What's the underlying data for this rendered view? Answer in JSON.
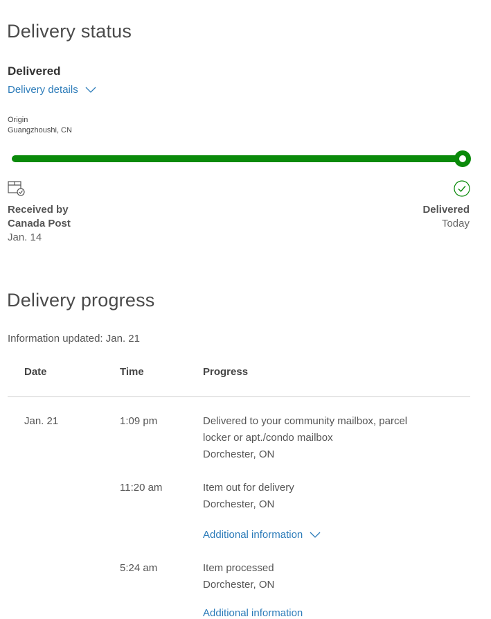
{
  "status": {
    "heading": "Delivery status",
    "value": "Delivered",
    "details_link": "Delivery details",
    "origin_label": "Origin",
    "origin_value": "Guangzhoushi, CN",
    "progress_fraction": 1.0,
    "start_milestone": {
      "line1": "Received by",
      "line2": "Canada Post",
      "date": "Jan. 14",
      "icon": "package-check-icon"
    },
    "end_milestone": {
      "label": "Delivered",
      "date": "Today",
      "icon": "check-circle-icon"
    },
    "accent_color": "#0a8a0a",
    "link_color": "#2b7bb9"
  },
  "progress": {
    "heading": "Delivery progress",
    "updated": "Information updated: Jan. 21",
    "columns": [
      "Date",
      "Time",
      "Progress"
    ],
    "rows": [
      {
        "date": "Jan. 21",
        "time": "1:09 pm",
        "line1": "Delivered to your community mailbox, parcel",
        "line2": "locker or apt./condo mailbox",
        "location": "Dorchester, ON"
      },
      {
        "date": "",
        "time": "11:20 am",
        "line1": "Item out for delivery",
        "location": "Dorchester, ON",
        "more_link": "Additional information"
      },
      {
        "date": "",
        "time": "5:24 am",
        "line1": "Item processed",
        "location": "Dorchester, ON",
        "more_link": "Additional information"
      }
    ]
  }
}
